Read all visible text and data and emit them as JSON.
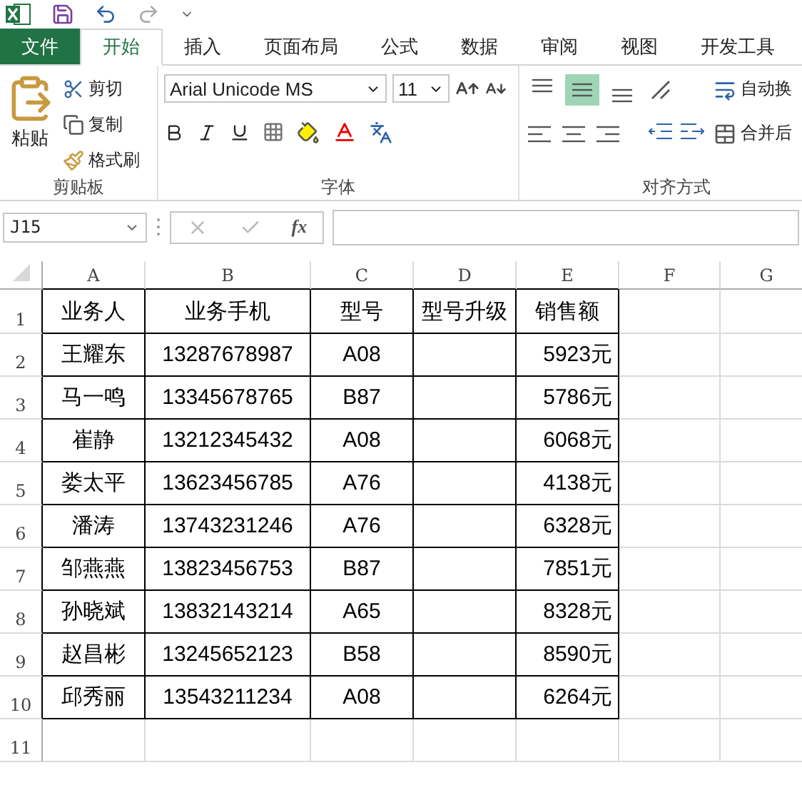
{
  "tabs": [
    {
      "label": "文件",
      "kind": "file",
      "selected": false
    },
    {
      "label": "开始",
      "kind": "tab",
      "selected": true
    },
    {
      "label": "插入",
      "kind": "tab",
      "selected": false
    },
    {
      "label": "页面布局",
      "kind": "tab",
      "selected": false
    },
    {
      "label": "公式",
      "kind": "tab",
      "selected": false
    },
    {
      "label": "数据",
      "kind": "tab",
      "selected": false
    },
    {
      "label": "审阅",
      "kind": "tab",
      "selected": false
    },
    {
      "label": "视图",
      "kind": "tab",
      "selected": false
    },
    {
      "label": "开发工具",
      "kind": "tab",
      "selected": false
    }
  ],
  "ribbon": {
    "clipboard": {
      "paste": "粘贴",
      "cut": "剪切",
      "copy": "复制",
      "format_painter": "格式刷",
      "title": "剪贴板"
    },
    "font": {
      "font_name": "Arial Unicode MS",
      "font_size": "11",
      "title": "字体"
    },
    "alignment": {
      "vertical": [
        {
          "kind": "top",
          "selected": false
        },
        {
          "kind": "middle",
          "selected": true
        },
        {
          "kind": "bottom",
          "selected": false
        }
      ],
      "wrap_text": "自动换",
      "merge": "合并后",
      "title": "对齐方式"
    }
  },
  "formula_bar": {
    "name_box": "J15",
    "function_label": "fx"
  },
  "sheet": {
    "columns": [
      "A",
      "B",
      "C",
      "D",
      "E",
      "F",
      "G"
    ],
    "row_numbers": [
      "1",
      "2",
      "3",
      "4",
      "5",
      "6",
      "7",
      "8",
      "9",
      "10",
      "11"
    ],
    "headers": [
      "业务人",
      "业务手机",
      "型号",
      "型号升级",
      "销售额"
    ],
    "records": [
      {
        "name": "王耀东",
        "phone": "13287678987",
        "model": "A08",
        "sales": "5923元"
      },
      {
        "name": "马一鸣",
        "phone": "13345678765",
        "model": "B87",
        "sales": "5786元"
      },
      {
        "name": "崔静",
        "phone": "13212345432",
        "model": "A08",
        "sales": "6068元"
      },
      {
        "name": "娄太平",
        "phone": "13623456785",
        "model": "A76",
        "sales": "4138元"
      },
      {
        "name": "潘涛",
        "phone": "13743231246",
        "model": "A76",
        "sales": "6328元"
      },
      {
        "name": "邹燕燕",
        "phone": "13823456753",
        "model": "B87",
        "sales": "7851元"
      },
      {
        "name": "孙晓斌",
        "phone": "13832143214",
        "model": "A65",
        "sales": "8328元"
      },
      {
        "name": "赵昌彬",
        "phone": "13245652123",
        "model": "B58",
        "sales": "8590元"
      },
      {
        "name": "邱秀丽",
        "phone": "13543211234",
        "model": "A08",
        "sales": "6264元"
      }
    ]
  }
}
